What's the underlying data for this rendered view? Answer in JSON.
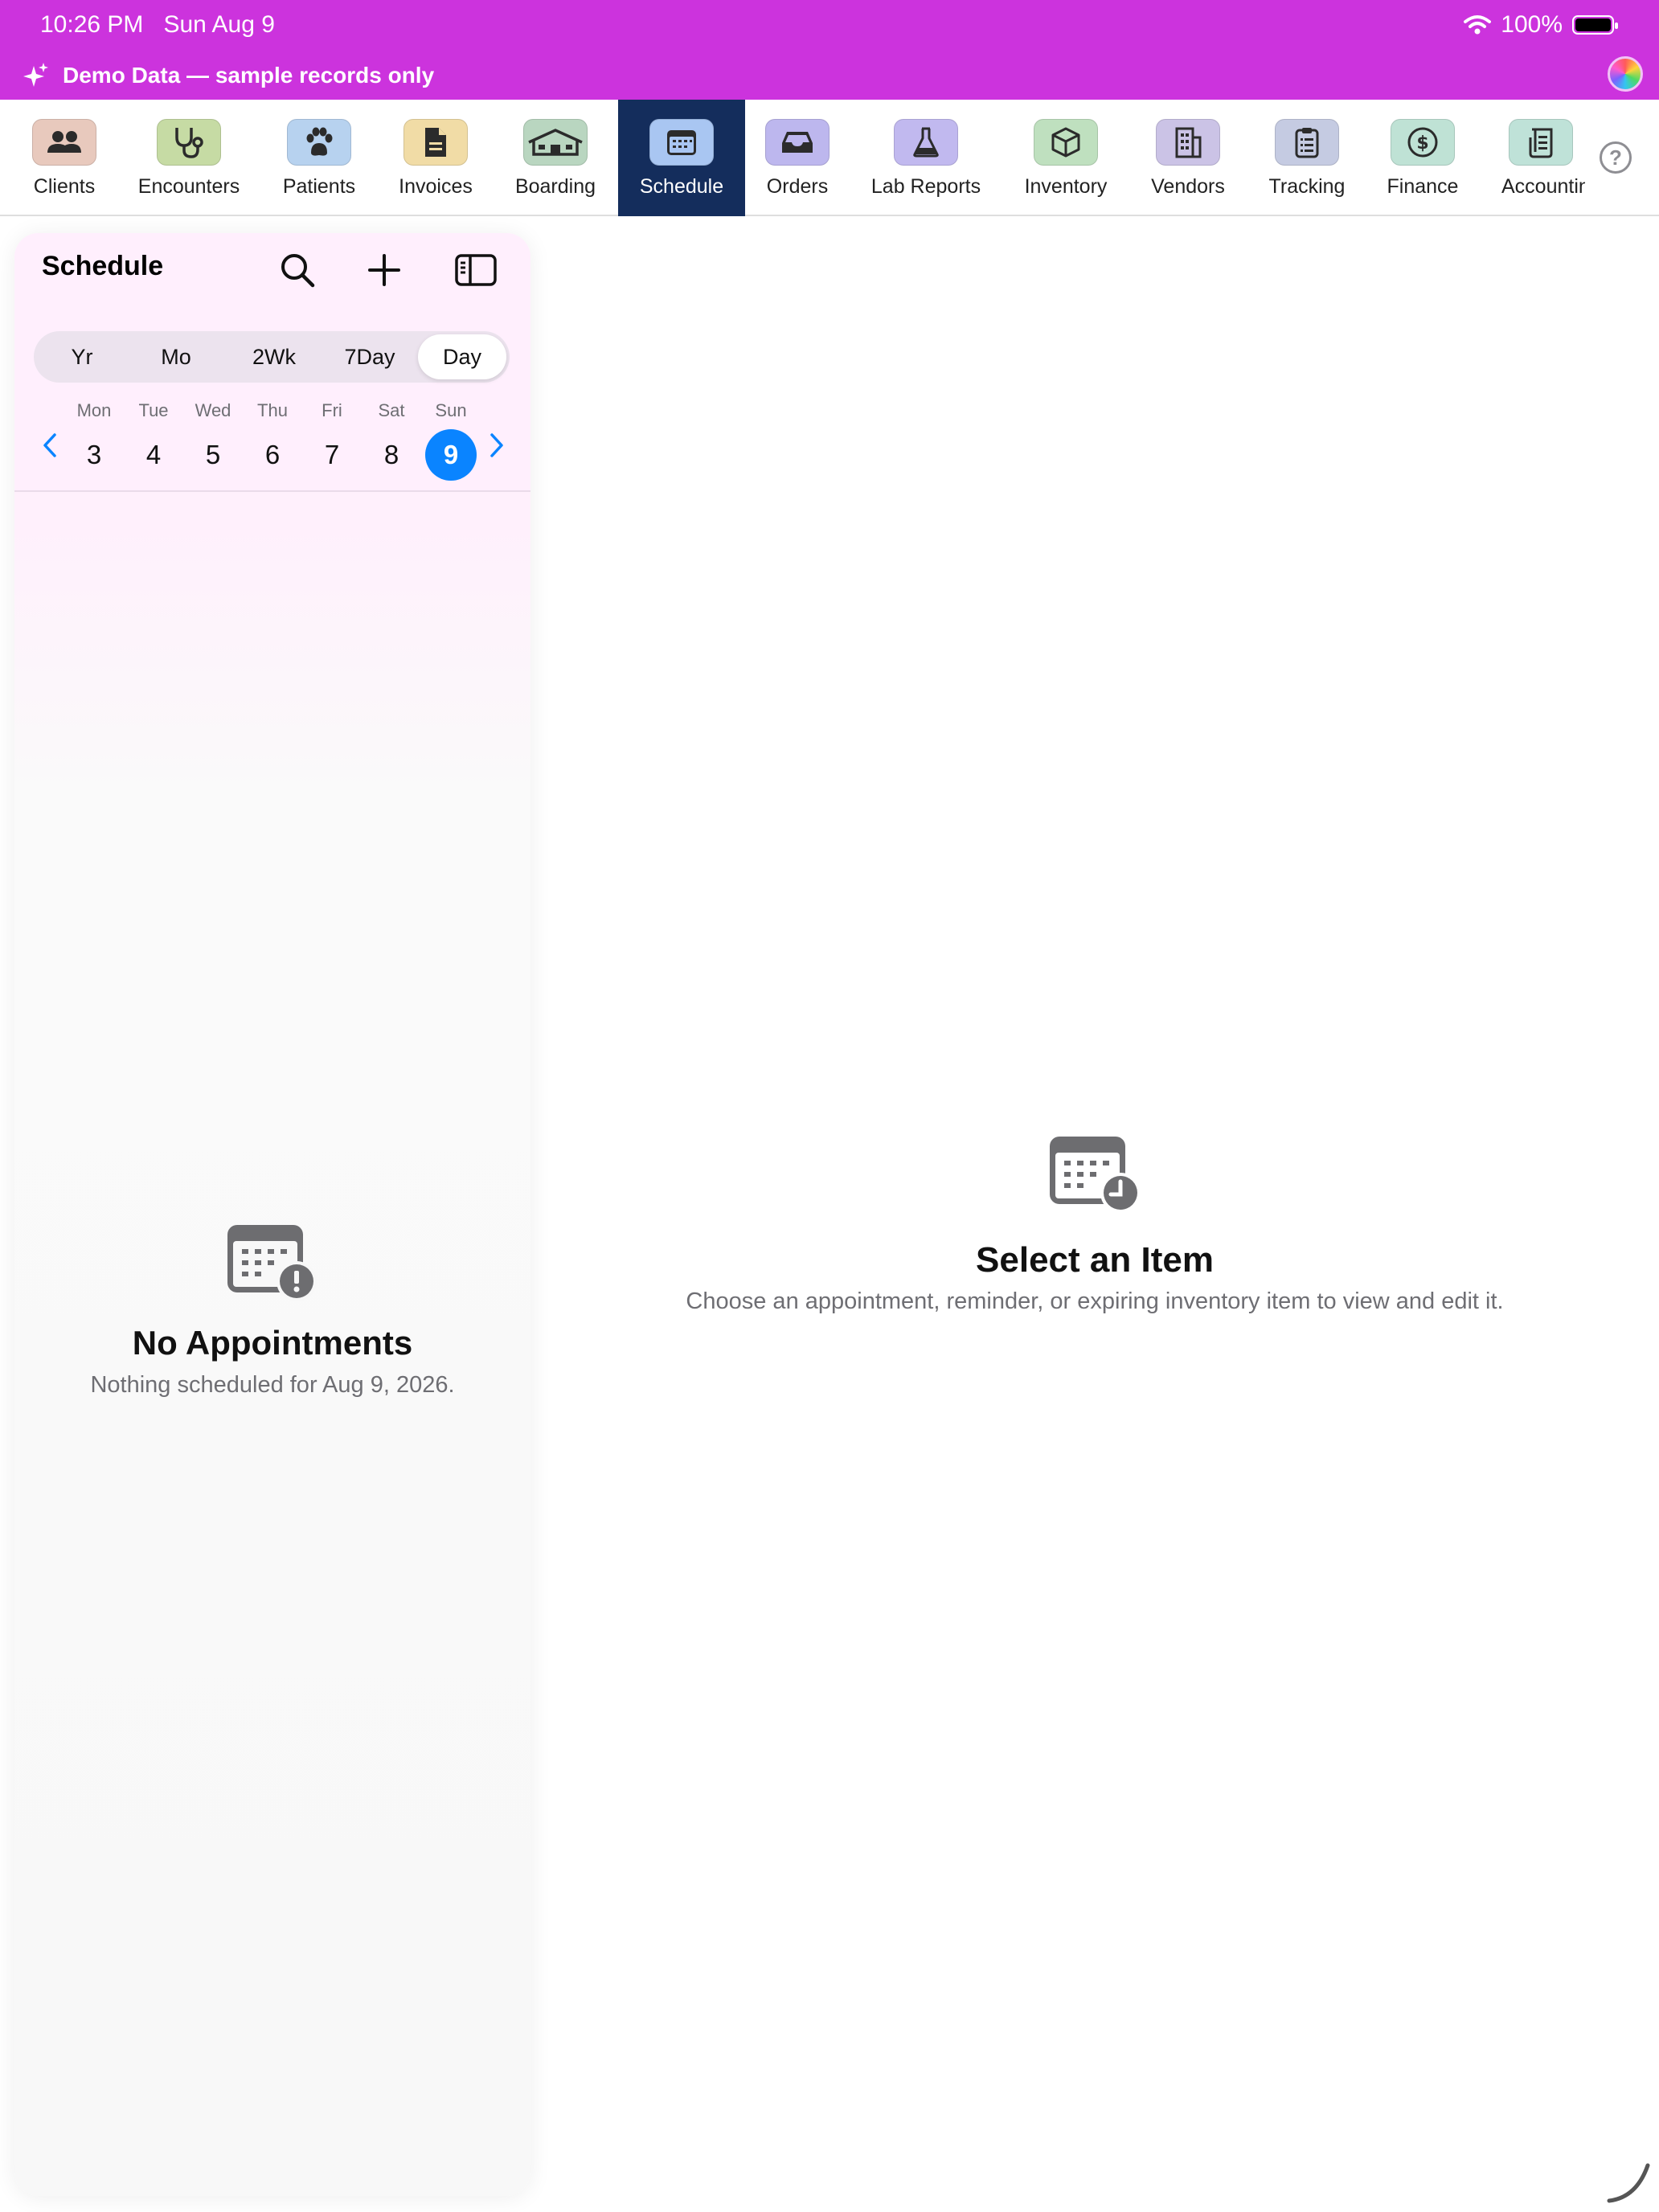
{
  "status_bar": {
    "time": "10:26 PM",
    "date": "Sun Aug 9",
    "battery": "100%",
    "wifi_icon": "wifi-icon"
  },
  "banner": {
    "text": "Demo Data — sample records only",
    "icon": "sparkles-icon",
    "color": "#cc33dd"
  },
  "modules": [
    {
      "label": "Clients",
      "icon": "people-icon",
      "color": "#e8c9bd"
    },
    {
      "label": "Encounters",
      "icon": "stethoscope-icon",
      "color": "#c6dba4"
    },
    {
      "label": "Patients",
      "icon": "paw-icon",
      "color": "#b7d2ef"
    },
    {
      "label": "Invoices",
      "icon": "document-icon",
      "color": "#f1dca6"
    },
    {
      "label": "Boarding",
      "icon": "house-icon",
      "color": "#b9d6c0"
    },
    {
      "label": "Schedule",
      "icon": "calendar-icon",
      "color": "#a9c6f2",
      "active": true
    },
    {
      "label": "Orders",
      "icon": "tray-icon",
      "color": "#bdb7ee"
    },
    {
      "label": "Lab Reports",
      "icon": "flask-icon",
      "color": "#c1b9ef"
    },
    {
      "label": "Inventory",
      "icon": "box-icon",
      "color": "#bfe0bf"
    },
    {
      "label": "Vendors",
      "icon": "building-icon",
      "color": "#cbc3e6"
    },
    {
      "label": "Tracking",
      "icon": "clipboard-icon",
      "color": "#c5cbe2"
    },
    {
      "label": "Finance",
      "icon": "dollar-icon",
      "color": "#bfe2d5"
    },
    {
      "label": "Accounting",
      "icon": "ledger-icon",
      "color": "#bfe2d8"
    }
  ],
  "accent": "#0a84ff",
  "active_tab_color": "#142d5c",
  "sidebar": {
    "title": "Schedule",
    "segments": [
      {
        "label": "Yr"
      },
      {
        "label": "Mo"
      },
      {
        "label": "2Wk"
      },
      {
        "label": "7Day"
      },
      {
        "label": "Day",
        "active": true
      }
    ],
    "week": [
      {
        "name": "Mon",
        "num": "3"
      },
      {
        "name": "Tue",
        "num": "4"
      },
      {
        "name": "Wed",
        "num": "5"
      },
      {
        "name": "Thu",
        "num": "6"
      },
      {
        "name": "Fri",
        "num": "7"
      },
      {
        "name": "Sat",
        "num": "8"
      },
      {
        "name": "Sun",
        "num": "9",
        "active": true
      }
    ],
    "empty": {
      "title": "No Appointments",
      "subtitle": "Nothing scheduled for Aug 9, 2026."
    }
  },
  "detail": {
    "title": "Select an Item",
    "subtitle": "Choose an appointment, reminder, or expiring inventory item to view and edit it."
  }
}
